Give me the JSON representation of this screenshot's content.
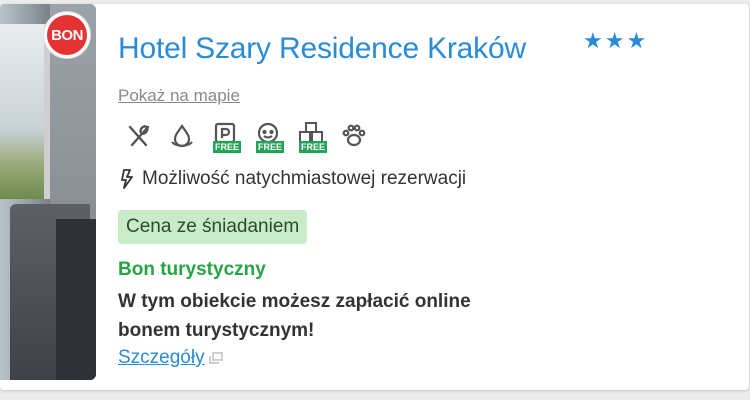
{
  "badge_bon": "BON",
  "hotel": {
    "name": "Hotel Szary Residence Kraków",
    "stars": "★★★",
    "map_link": "Pokaż na mapie"
  },
  "amenities": [
    {
      "icon": "restaurant-icon"
    },
    {
      "icon": "water-drop-icon"
    },
    {
      "icon": "parking-icon",
      "badge": "FREE"
    },
    {
      "icon": "baby-icon",
      "badge": "FREE"
    },
    {
      "icon": "blocks-icon",
      "badge": "FREE"
    },
    {
      "icon": "paw-icon"
    }
  ],
  "instant_booking": "Możliwość natychmiastowej rezerwacji",
  "price_badge": "Cena ze śniadaniem",
  "bon_turystyczny": {
    "heading": "Bon turystyczny",
    "text": "W tym obiekcie możesz zapłacić online bonem turystycznym!",
    "details_link": "Szczegóły"
  },
  "colors": {
    "accent": "#2a8bd6",
    "green": "#27a545",
    "badge_bg": "#c8ecc7",
    "bon_red": "#e53232"
  }
}
